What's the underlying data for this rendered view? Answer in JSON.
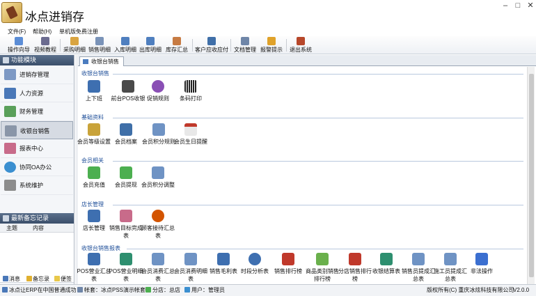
{
  "app": {
    "title": "冰点进销存"
  },
  "window": {
    "minimize": "–",
    "maximize": "□",
    "close": "✕"
  },
  "menu": [
    "文件(F)",
    "帮助(H)",
    "单机版免费注册"
  ],
  "toolbar": [
    "操作向导",
    "视频教程",
    "采购明细",
    "销售明细",
    "入库明细",
    "出库明细",
    "库存汇总",
    "客户应收应付",
    "文档管理",
    "报警提示",
    "退出系统"
  ],
  "sidebar": {
    "header": "功能模块",
    "items": [
      "进销存管理",
      "人力资源",
      "财务管理",
      "收银台销售",
      "报表中心",
      "协同OA办公",
      "系统维护"
    ]
  },
  "memo": {
    "header": "最新备忘记录",
    "columns": [
      "主题",
      "内容"
    ],
    "buttons": [
      "消息",
      "备忘录",
      "便签"
    ]
  },
  "tab": {
    "label": "收银台销售"
  },
  "sections": [
    {
      "title": "收银台销售",
      "items": [
        "上下班",
        "前台POS收银",
        "促销规则",
        "条码打印"
      ]
    },
    {
      "title": "基础资料",
      "items": [
        "会员等级设置",
        "会员档案",
        "会员积分规则",
        "会员生日提醒"
      ]
    },
    {
      "title": "会员相关",
      "items": [
        "会员充值",
        "会员提现",
        "会员积分调整"
      ]
    },
    {
      "title": "店长管理",
      "items": [
        "店长管理",
        "销售目标完成表",
        "顾客接待汇总表"
      ]
    },
    {
      "title": "收银台销售报表",
      "items": [
        "POS营业汇总表",
        "POS营业明细表",
        "会员消费汇总表",
        "会员消费明细表",
        "销售毛利表",
        "时段分析表",
        "销售排行榜",
        "商品类别销售排行榜",
        "分店销售排行榜",
        "收银结算表",
        "销售员提成汇总表",
        "施工员提成汇总表",
        "非法操作"
      ]
    }
  ],
  "status": {
    "msg": "冰点让ERP在中国普通成功",
    "account": "帐套：冰点PSS演示帐套",
    "branch": "分店：总店",
    "user": "用户：管理员",
    "copyright": "版权所有(C) 重庆冰炫科技有限公司",
    "version": "V2.0.0"
  },
  "colors": {
    "accent": "#3b4f6b",
    "section_title": "#1f4f99"
  }
}
